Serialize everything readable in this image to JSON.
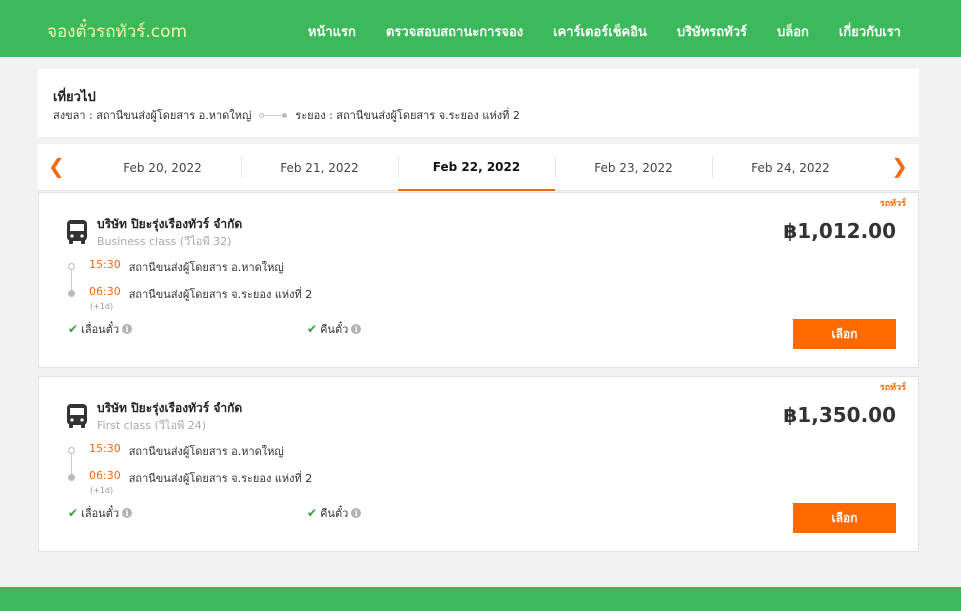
{
  "site": {
    "logo": "จองตั๋วรถทัวร์.com"
  },
  "nav": [
    "หน้าแรก",
    "ตรวจสอบสถานะการจอง",
    "เคาร์เตอร์เช็คอิน",
    "บริษัทรถทัวร์",
    "บล็อก",
    "เกี่ยวกับเรา"
  ],
  "trip": {
    "title": "เที่ยวไป",
    "origin": "สงขลา : สถานีขนส่งผู้โดยสาร อ.หาดใหญ่",
    "destination": "ระยอง : สถานีขนส่งผู้โดยสาร จ.ระยอง แห่งที่ 2"
  },
  "dates": [
    "Feb 20, 2022",
    "Feb 21, 2022",
    "Feb 22, 2022",
    "Feb 23, 2022",
    "Feb 24, 2022"
  ],
  "active_date": "Feb 22, 2022",
  "colors": {
    "brand_green": "#3cb95b",
    "accent_orange": "#ff6a00",
    "time_orange": "#f26b0f",
    "check_green": "#2e9f3e"
  },
  "icons": {
    "prev": "chevron-left-icon",
    "next": "chevron-right-icon",
    "bus": "bus-icon",
    "check": "check-icon",
    "info": "info-icon"
  },
  "results": [
    {
      "tag": "รถทัวร์",
      "company": "บริษัท ปิยะรุ่งเรืองทัวร์ จำกัด",
      "bus_class": "Business class (วีไอพี 32)",
      "price": "฿1,012.00",
      "depart_time": "15:30",
      "depart_place": "สถานีขนส่งผู้โดยสาร อ.หาดใหญ่",
      "arrive_time": "06:30",
      "arrive_place": "สถานีขนส่งผู้โดยสาร จ.ระยอง แห่งที่ 2",
      "day_offset": "(+1d)",
      "policy_reschedule": "เลื่อนตั๋ว",
      "policy_refund": "คืนตั๋ว",
      "button": "เลือก"
    },
    {
      "tag": "รถทัวร์",
      "company": "บริษัท ปิยะรุ่งเรืองทัวร์ จำกัด",
      "bus_class": "First class (วีไอพี 24)",
      "price": "฿1,350.00",
      "depart_time": "15:30",
      "depart_place": "สถานีขนส่งผู้โดยสาร อ.หาดใหญ่",
      "arrive_time": "06:30",
      "arrive_place": "สถานีขนส่งผู้โดยสาร จ.ระยอง แห่งที่ 2",
      "day_offset": "(+1d)",
      "policy_reschedule": "เลื่อนตั๋ว",
      "policy_refund": "คืนตั๋ว",
      "button": "เลือก"
    }
  ]
}
